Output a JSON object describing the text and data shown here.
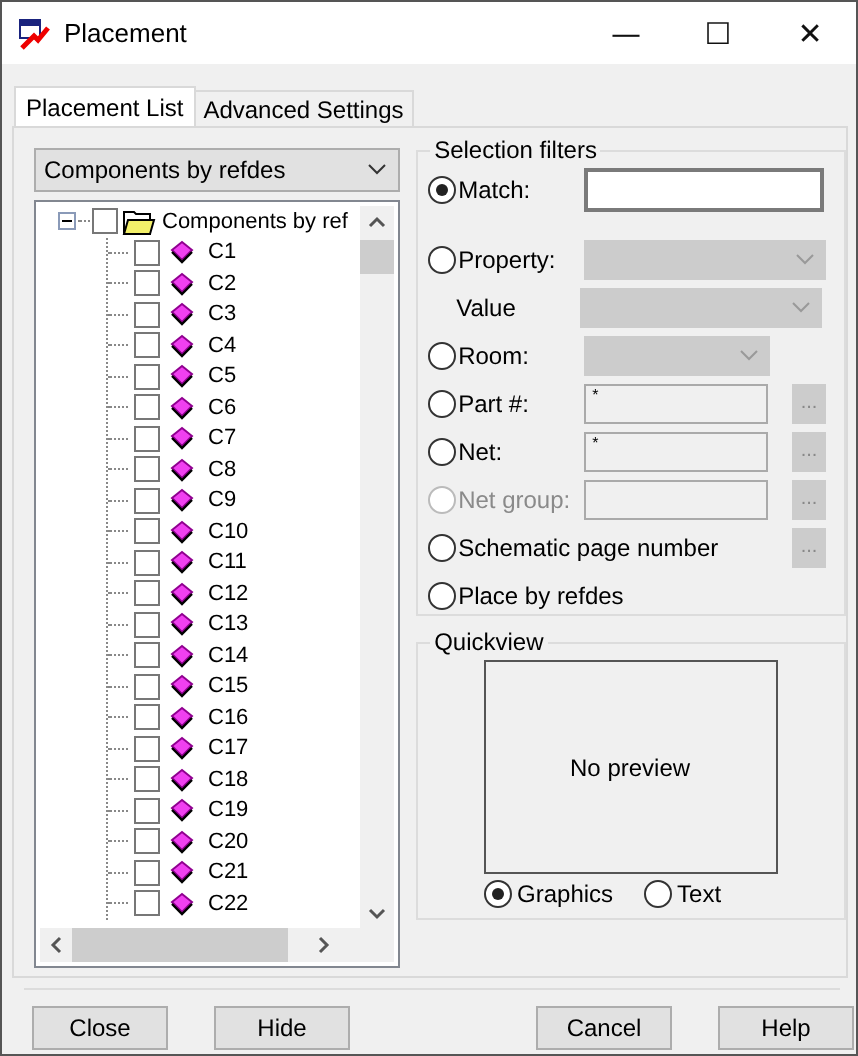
{
  "window": {
    "title": "Placement",
    "controls": [
      "—",
      "☐",
      "✕"
    ]
  },
  "tabs": [
    {
      "label": "Placement List",
      "selected": true
    },
    {
      "label": "Advanced Settings",
      "selected": false
    }
  ],
  "list_dropdown": {
    "value": "Components by refdes"
  },
  "tree": {
    "label": "Components by ref",
    "expanded": true,
    "checked": false,
    "children": [
      {
        "label": "C1",
        "checked": false
      },
      {
        "label": "C2",
        "checked": false
      },
      {
        "label": "C3",
        "checked": false
      },
      {
        "label": "C4",
        "checked": false
      },
      {
        "label": "C5",
        "checked": false
      },
      {
        "label": "C6",
        "checked": false
      },
      {
        "label": "C7",
        "checked": false
      },
      {
        "label": "C8",
        "checked": false
      },
      {
        "label": "C9",
        "checked": false
      },
      {
        "label": "C10",
        "checked": false
      },
      {
        "label": "C11",
        "checked": false
      },
      {
        "label": "C12",
        "checked": false
      },
      {
        "label": "C13",
        "checked": false
      },
      {
        "label": "C14",
        "checked": false
      },
      {
        "label": "C15",
        "checked": false
      },
      {
        "label": "C16",
        "checked": false
      },
      {
        "label": "C17",
        "checked": false
      },
      {
        "label": "C18",
        "checked": false
      },
      {
        "label": "C19",
        "checked": false
      },
      {
        "label": "C20",
        "checked": false
      },
      {
        "label": "C21",
        "checked": false
      },
      {
        "label": "C22",
        "checked": false
      }
    ]
  },
  "selection_filters": {
    "title": "Selection filters",
    "rows": [
      {
        "kind": "radio",
        "label": "Match:",
        "selected": true,
        "disabled": false,
        "field": {
          "kind": "input",
          "disabled": false
        }
      },
      {
        "kind": "radio",
        "label": "Property:",
        "selected": false,
        "disabled": false,
        "field": {
          "kind": "dropdown",
          "disabled": true
        }
      },
      {
        "kind": "label",
        "label": "Value",
        "field": {
          "kind": "dropdown",
          "disabled": true
        }
      },
      {
        "kind": "radio",
        "label": "Room:",
        "selected": false,
        "disabled": false,
        "field": {
          "kind": "short-dropdown",
          "disabled": true
        }
      },
      {
        "kind": "radio",
        "label": "Part #:",
        "selected": false,
        "disabled": false,
        "field": {
          "kind": "input",
          "disabled": true,
          "value": "*"
        },
        "browse": "..."
      },
      {
        "kind": "radio",
        "label": "Net:",
        "selected": false,
        "disabled": false,
        "field": {
          "kind": "input",
          "disabled": true,
          "value": "*"
        },
        "browse": "..."
      },
      {
        "kind": "radio",
        "label": "Net group:",
        "selected": false,
        "disabled": true,
        "field": {
          "kind": "input",
          "disabled": true
        },
        "browse": "..."
      },
      {
        "kind": "radio",
        "label": "Schematic page number",
        "selected": false,
        "disabled": false,
        "browse": "..."
      },
      {
        "kind": "radio",
        "label": "Place by refdes",
        "selected": false,
        "disabled": false
      }
    ]
  },
  "quickview": {
    "title": "Quickview",
    "preview_text": "No preview",
    "modes": [
      {
        "label": "Graphics",
        "selected": true
      },
      {
        "label": "Text",
        "selected": false
      }
    ]
  },
  "buttons": [
    "Close",
    "Hide",
    "Cancel",
    "Help"
  ]
}
